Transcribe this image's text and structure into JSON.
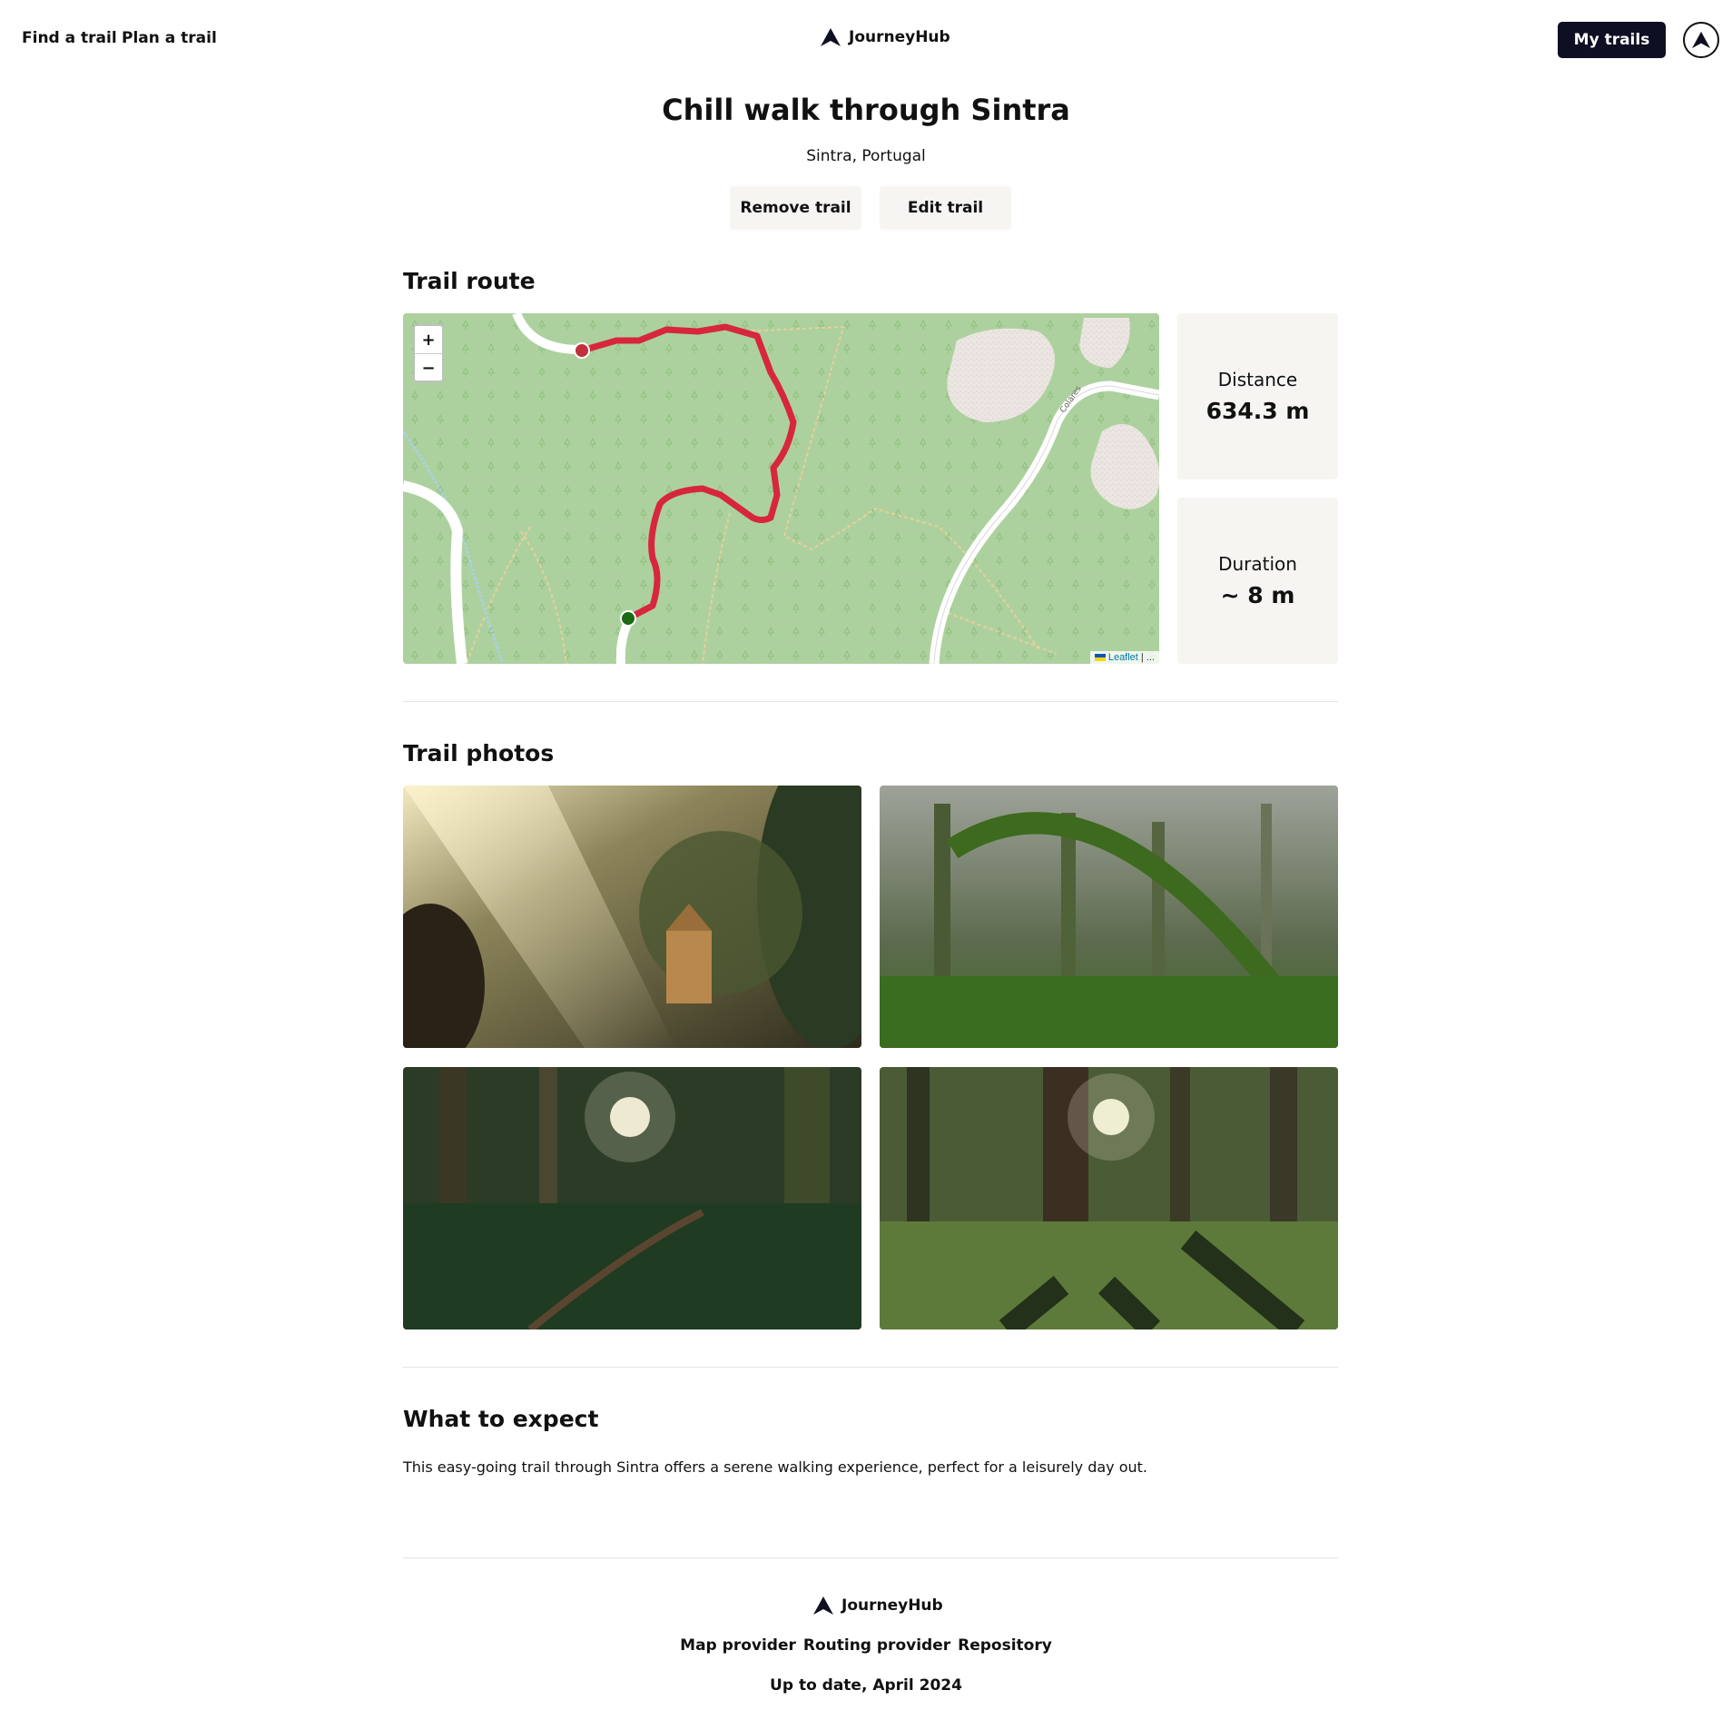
{
  "header": {
    "nav": [
      {
        "label": "Find a trail"
      },
      {
        "label": "Plan a trail"
      }
    ],
    "brand": "JourneyHub",
    "my_trails_label": "My trails",
    "profile_icon": "mountain-logo-icon"
  },
  "trail": {
    "title": "Chill walk through Sintra",
    "location": "Sintra, Portugal",
    "remove_label": "Remove trail",
    "edit_label": "Edit trail"
  },
  "route": {
    "heading": "Trail route",
    "zoom_in": "+",
    "zoom_out": "−",
    "road_label": "Colares",
    "attribution_link": "Leaflet",
    "attribution_sep": " | ...",
    "route_color": "#d7263d",
    "start_color": "#1a6b12",
    "end_color": "#c0313b",
    "stats": [
      {
        "label": "Distance",
        "value": "634.3 m"
      },
      {
        "label": "Duration",
        "value": "~ 8 m"
      }
    ]
  },
  "photos": {
    "heading": "Trail photos",
    "items": [
      {
        "name": "sunlit-palace-forest-photo"
      },
      {
        "name": "ivy-arch-forest-photo"
      },
      {
        "name": "forest-path-sunburst-photo"
      },
      {
        "name": "forest-shadows-sunburst-photo"
      }
    ]
  },
  "expect": {
    "heading": "What to expect",
    "text": "This easy-going trail through Sintra offers a serene walking experience, perfect for a leisurely day out."
  },
  "footer": {
    "brand": "JourneyHub",
    "links": [
      "Map provider",
      "Routing provider",
      "Repository"
    ],
    "updated": "Up to date, April 2024"
  },
  "colors": {
    "primary_dark": "#0f0f23",
    "card_bg": "#f6f5f1",
    "map_forest": "#add19e"
  }
}
